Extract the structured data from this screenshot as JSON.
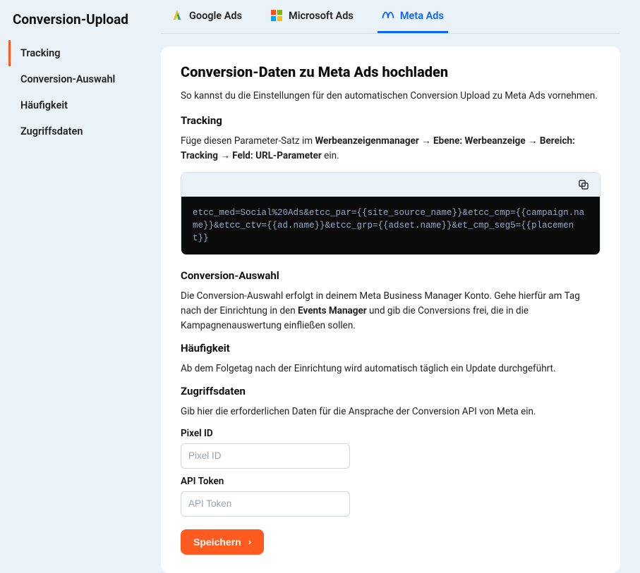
{
  "page_title": "Conversion-Upload",
  "sidebar": {
    "items": [
      {
        "label": "Tracking",
        "active": true
      },
      {
        "label": "Conversion-Auswahl",
        "active": false
      },
      {
        "label": "Häufigkeit",
        "active": false
      },
      {
        "label": "Zugriffsdaten",
        "active": false
      }
    ]
  },
  "tabs": [
    {
      "id": "google",
      "label": "Google Ads",
      "active": false
    },
    {
      "id": "microsoft",
      "label": "Microsoft Ads",
      "active": false
    },
    {
      "id": "meta",
      "label": "Meta Ads",
      "active": true
    }
  ],
  "content": {
    "title": "Conversion-Daten zu Meta Ads hochladen",
    "intro": "So kannst du die Einstellungen für den automatischen Conversion Upload zu Meta Ads vornehmen.",
    "tracking": {
      "heading": "Tracking",
      "lead": "Füge diesen Parameter-Satz im ",
      "path1": "Werbeanzeigenmanager",
      "arrow": " → ",
      "path2": "Ebene: Werbeanzeige",
      "path3": "Bereich: Tracking",
      "path4": "Feld: URL-Parameter",
      "trail": " ein.",
      "code": "etcc_med=Social%20Ads&etcc_par={{site_source_name}}&etcc_cmp={{campaign.name}}&etcc_ctv={{ad.name}}&etcc_grp={{adset.name}}&et_cmp_seg5={{placement}}"
    },
    "conversion": {
      "heading": "Conversion-Auswahl",
      "text_pre": "Die Conversion-Auswahl erfolgt in deinem Meta Business Manager Konto. Gehe hierfür am Tag nach der Einrichtung in den ",
      "bold": "Events Manager",
      "text_post": " und gib die Conversions frei, die in die Kampagnenauswertung einfließen sollen."
    },
    "frequency": {
      "heading": "Häufigkeit",
      "text": "Ab dem Folgetag nach der Einrichtung wird automatisch täglich ein Update durchgeführt."
    },
    "access": {
      "heading": "Zugriffsdaten",
      "text": "Gib hier die erforderlichen Daten für die Ansprache der Conversion API von Meta ein.",
      "pixel_label": "Pixel ID",
      "pixel_placeholder": "Pixel ID",
      "token_label": "API Token",
      "token_placeholder": "API Token"
    },
    "save_label": "Speichern"
  }
}
